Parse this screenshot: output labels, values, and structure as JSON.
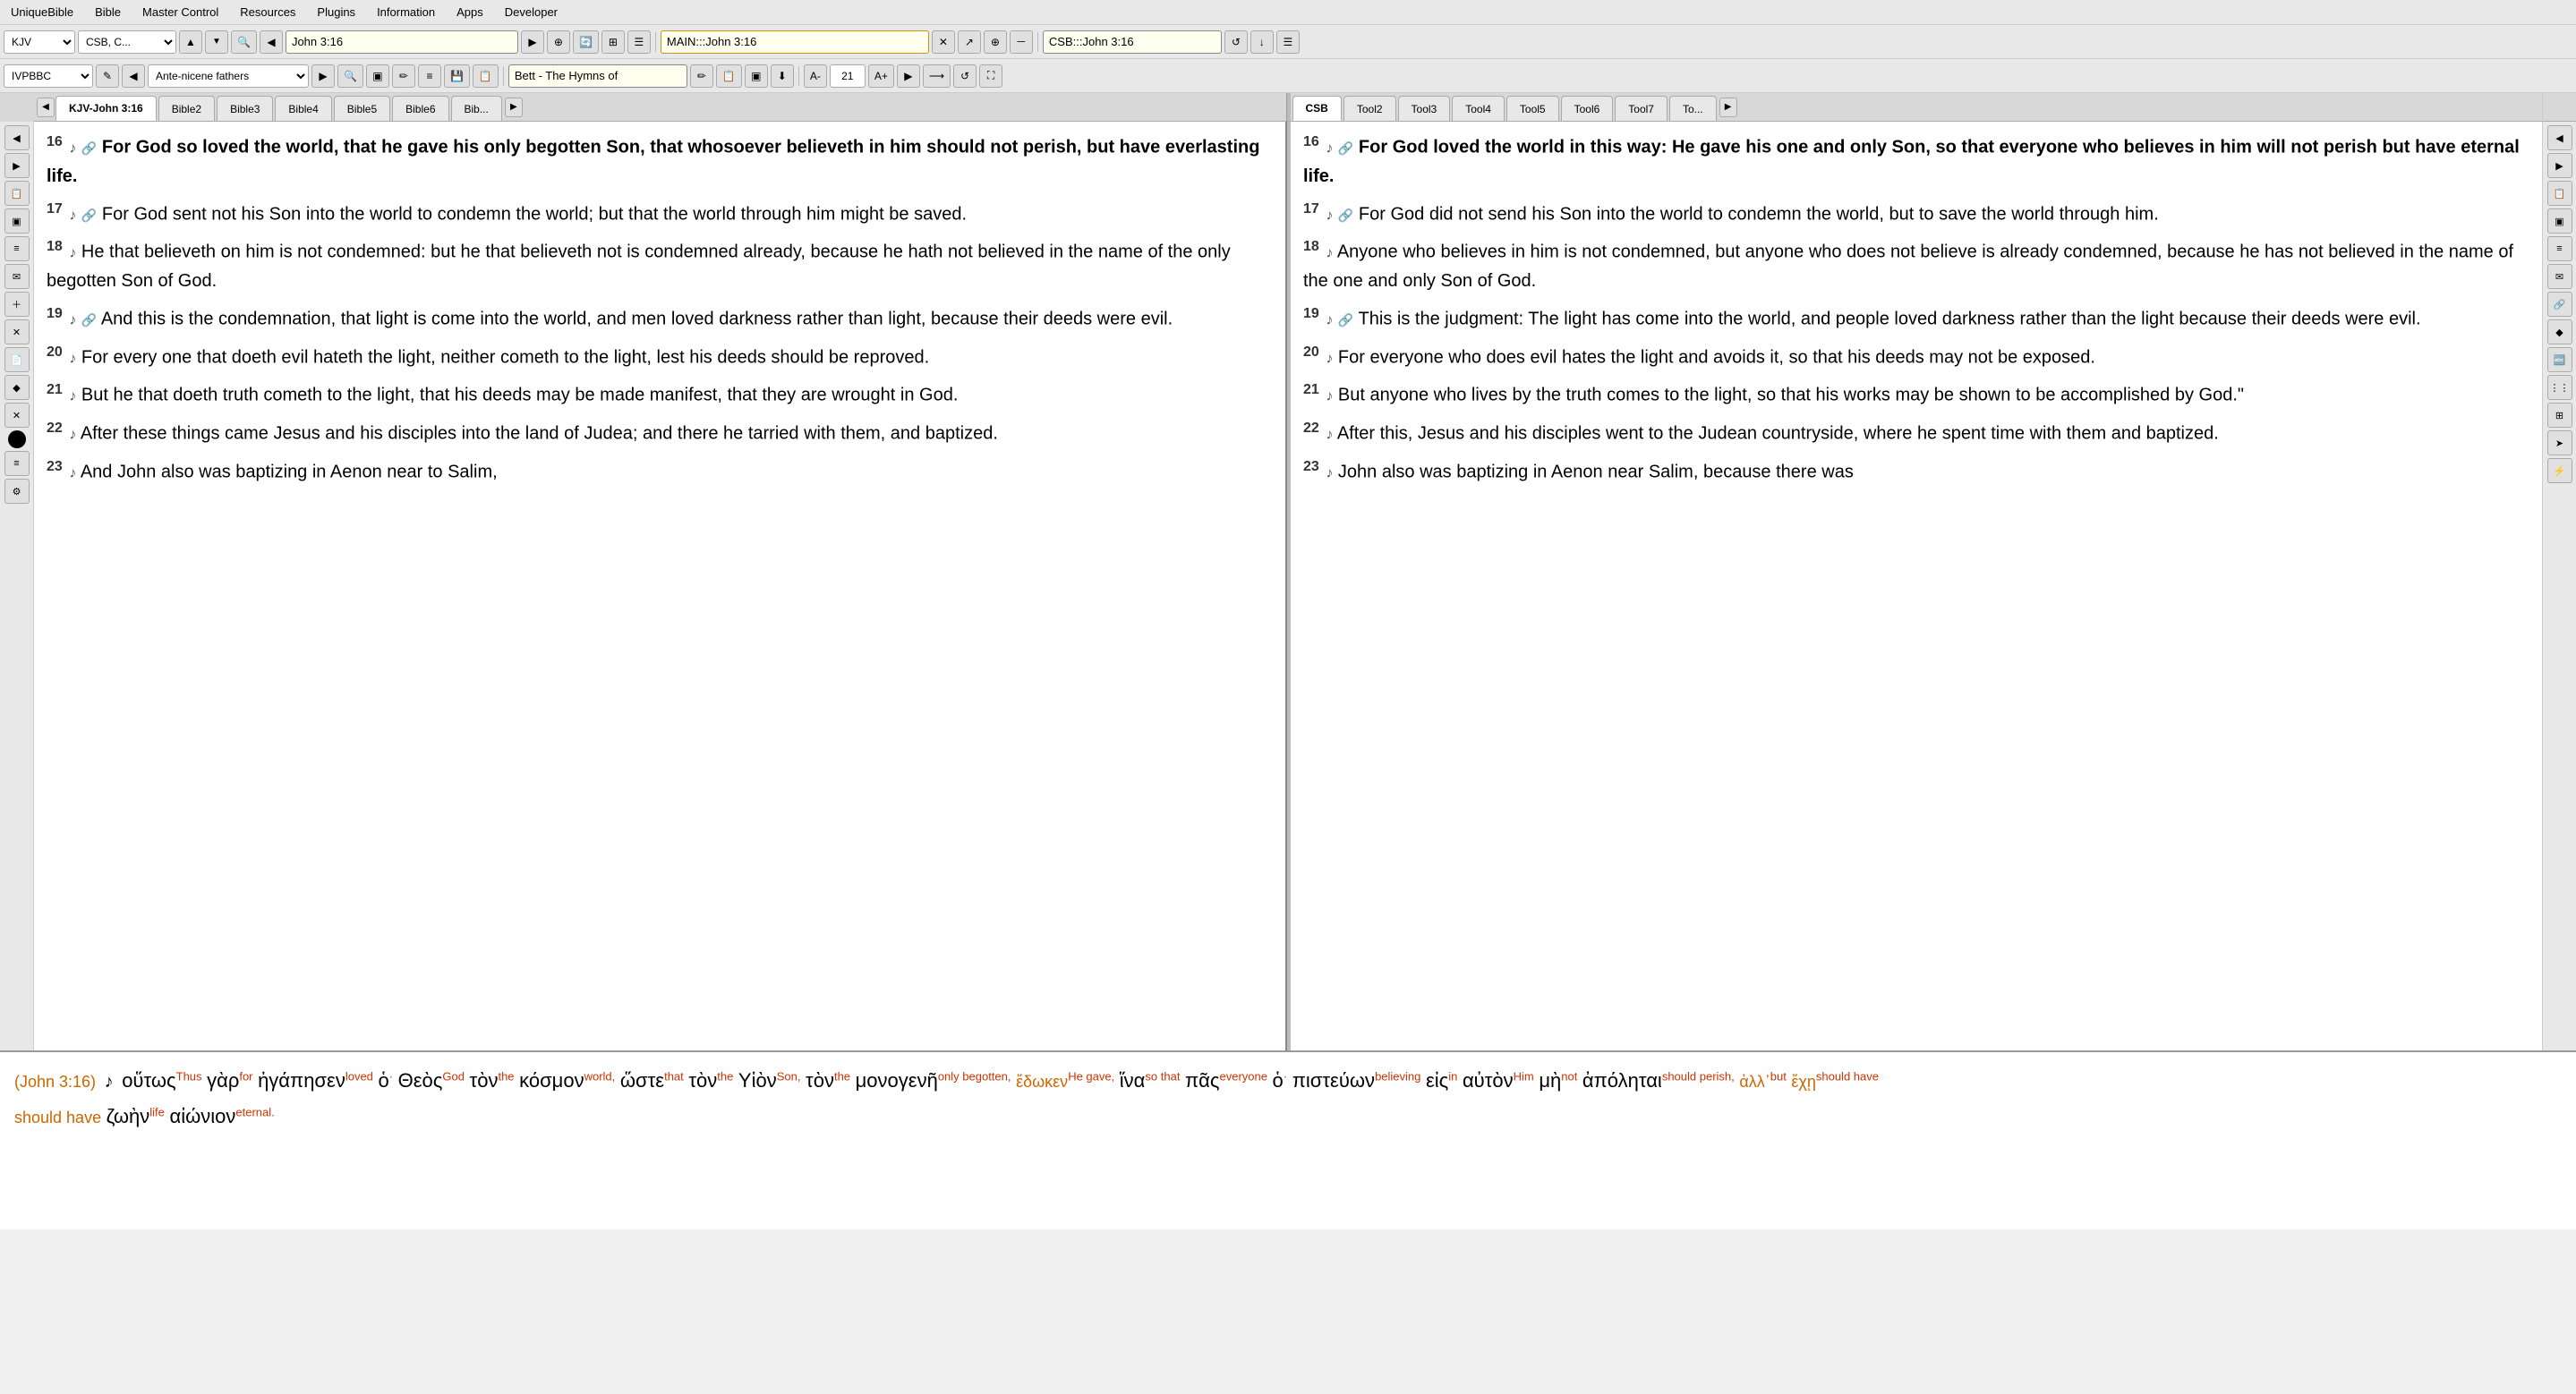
{
  "menubar": {
    "items": [
      "UniqueBible",
      "Bible",
      "Master Control",
      "Resources",
      "Plugins",
      "Information",
      "Apps",
      "Developer"
    ]
  },
  "toolbar1": {
    "version_select": "KJV",
    "commentary_select": "CSB, C...",
    "nav_prev": "◀",
    "nav_next": "▶",
    "reference_value": "John 3:16",
    "reference_placeholder": "John 3:16",
    "main_ref_value": "MAIN:::John 3:16",
    "clear_icon": "✕",
    "external_icon": "↗",
    "share_icon": "⊕",
    "zoom_out_icon": "－",
    "csb_ref": "CSB:::John 3:16",
    "refresh_icon": "↺",
    "download_icon": "↓",
    "menu_icon": "☰"
  },
  "toolbar2": {
    "font_select": "IVPBBC",
    "note_icon": "✎",
    "nav_prev": "◀",
    "book_select": "Ante-nicene fathers",
    "nav_next": "▶",
    "search_icon": "🔍",
    "icons": [
      "▣",
      "✏",
      "≡",
      "💾",
      "📋",
      "🔔"
    ],
    "title_display": "Bett - The Hymns of",
    "edit_icon": "✏",
    "icons2": [
      "📋",
      "▣",
      "⬇"
    ],
    "font_smaller": "A-",
    "font_size": "21",
    "font_larger": "A+",
    "play_icon": "▶",
    "nav_icon": "⟶",
    "refresh_icon": "↺",
    "fullscreen_icon": "⛶"
  },
  "tabs_left": {
    "nav_prev": "◀",
    "items": [
      "KJV-John 3:16",
      "Bible2",
      "Bible3",
      "Bible4",
      "Bible5",
      "Bible6",
      "Bib..."
    ],
    "active": "KJV-John 3:16",
    "nav_next": "▶"
  },
  "tabs_right": {
    "items": [
      "CSB",
      "Tool2",
      "Tool3",
      "Tool4",
      "Tool5",
      "Tool6",
      "Tool7",
      "To..."
    ],
    "active": "CSB",
    "nav_next": "▶"
  },
  "left_sidebar_buttons": [
    "◀",
    "▶",
    "📋",
    "▣",
    "≡",
    "📧",
    "➕",
    "✕",
    "📋",
    "◆",
    "✕",
    "●",
    "≡",
    "⚙"
  ],
  "right_sidebar_buttons": [
    "◀",
    "▶",
    "📋",
    "▣",
    "≡",
    "📧",
    "➕",
    "✕",
    "◆",
    "✕",
    "≡",
    "⚙",
    "⚡"
  ],
  "kjv_panel": {
    "verses": [
      {
        "num": "16",
        "music": "♪",
        "link": "🔗",
        "text": " For God so loved the world, that he gave his only begotten Son, that whosoever believeth in him should not perish, but have everlasting life."
      },
      {
        "num": "17",
        "music": "♪",
        "link": "🔗",
        "text": " For God sent not his Son into the world to condemn the world; but that the world through him might be saved."
      },
      {
        "num": "18",
        "music": "♪",
        "text": " He that believeth on him is not condemned: but he that believeth not is condemned already, because he hath not believed in the name of the only begotten Son of God."
      },
      {
        "num": "19",
        "music": "♪",
        "link": "🔗",
        "text": " And this is the condemnation, that light is come into the world, and men loved darkness rather than light, because their deeds were evil."
      },
      {
        "num": "20",
        "music": "♪",
        "text": " For every one that doeth evil hateth the light, neither cometh to the light, lest his deeds should be reproved."
      },
      {
        "num": "21",
        "music": "♪",
        "text": " But he that doeth truth cometh to the light, that his deeds may be made manifest, that they are wrought in God."
      },
      {
        "num": "22",
        "music": "♪",
        "text": " After these things came Jesus and his disciples into the land of Judea; and there he tarried with them, and baptized."
      },
      {
        "num": "23",
        "music": "♪",
        "text": " And John also was baptizing in Aenon near to Salim,"
      }
    ]
  },
  "csb_panel": {
    "verses": [
      {
        "num": "16",
        "music": "♪",
        "link": "🔗",
        "text": " For God loved the world in this way: He gave his one and only Son, so that everyone who believes in him will not perish but have eternal life."
      },
      {
        "num": "17",
        "music": "♪",
        "link": "🔗",
        "text": " For God did not send his Son into the world to condemn the world, but to save the world through him."
      },
      {
        "num": "18",
        "music": "♪",
        "text": " Anyone who believes in him is not condemned, but anyone who does not believe is already condemned, because he has not believed in the name of the one and only Son of God."
      },
      {
        "num": "19",
        "music": "♪",
        "link": "🔗",
        "text": " This is the judgment: The light has come into the world, and people loved darkness rather than the light because their deeds were evil."
      },
      {
        "num": "20",
        "music": "♪",
        "text": " For everyone who does evil hates the light and avoids it, so that his deeds may not be exposed."
      },
      {
        "num": "21",
        "music": "♪",
        "text": " But anyone who lives by the truth comes to the light, so that his works may be shown to be accomplished by God.\""
      },
      {
        "num": "22",
        "music": "♪",
        "text": " After this, Jesus and his disciples went to the Judean countryside, where he spent time with them and baptized."
      },
      {
        "num": "23",
        "music": "♪",
        "text": " John also was baptizing in Aenon near Salim, because there was"
      }
    ]
  },
  "interlinear": {
    "ref": "(John 3:16)",
    "content": "οὕτως<sup>Thus</sup> γὰρ<sup>for</sup> ἠγάπησεν<sup>loved</sup> ὁ<sup>·</sup> Θεὸς<sup>God</sup> τὸν<sup>the</sup> κόσμον<sup>world,</sup> ὥστε<sup>that</sup> τὸν<sup>the</sup> Υἱὸν<sup>Son,</sup> τὸν<sup>the</sup> μονογενῆ<sup>only begotten,</sup> ἔδωκεν<sup>He gave,</sup> ἵνα<sup>so that</sup> πᾶς<sup>everyone</sup> ὁ<sup>·</sup> πιστεύων<sup>believing</sup> εἰς<sup>in</sup> αὐτὸν<sup>Him</sup> μὴ<sup>not</sup> ἀπόληται<sup>should perish,</sup> ἀλλ᾽<sup>but</sup> ἔχῃ<sup>should have</sup> ζωὴν<sup>life</sup> αἰώνιον<sup>eternal.</sup>"
  }
}
